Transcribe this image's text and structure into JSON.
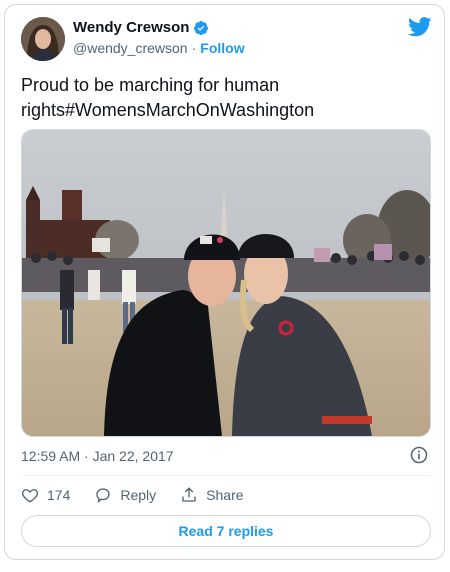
{
  "tweet": {
    "author": {
      "display_name": "Wendy Crewson",
      "handle": "@wendy_crewson",
      "separator": "·",
      "follow_label": "Follow",
      "verified": true
    },
    "text": "Proud to be marching for human\nrights#WomensMarchOnWashington",
    "timestamp": "12:59 AM · Jan 22, 2017",
    "actions": {
      "likes_count": "174",
      "reply_label": "Reply",
      "share_label": "Share"
    },
    "read_replies_label": "Read 7 replies"
  },
  "icons": [
    "twitter-bird-icon",
    "verified-badge-icon",
    "info-icon",
    "heart-icon",
    "reply-icon",
    "share-icon"
  ],
  "colors": {
    "accent": "#1d9bf0",
    "text": "#0f1419",
    "muted": "#536471",
    "border": "#cfd9de"
  }
}
